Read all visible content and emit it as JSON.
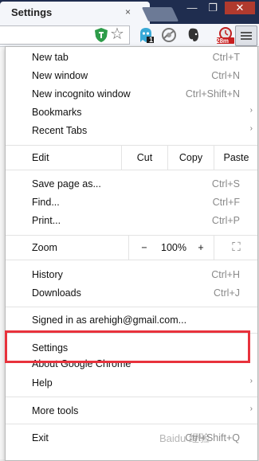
{
  "tab": {
    "title": "Settings",
    "close": "×"
  },
  "window_controls": {
    "minimize": "—",
    "maximize": "❐",
    "close": "✕"
  },
  "toolbar": {
    "star": "☆",
    "timer_badge": "28m",
    "ghost_badge": "1"
  },
  "menu": {
    "items_top": [
      {
        "label": "New tab",
        "shortcut": "Ctrl+T"
      },
      {
        "label": "New window",
        "shortcut": "Ctrl+N"
      },
      {
        "label": "New incognito window",
        "shortcut": "Ctrl+Shift+N"
      },
      {
        "label": "Bookmarks",
        "submenu": "›"
      },
      {
        "label": "Recent Tabs",
        "submenu": "›"
      }
    ],
    "edit": {
      "label": "Edit",
      "cut": "Cut",
      "copy": "Copy",
      "paste": "Paste"
    },
    "items_page": [
      {
        "label": "Save page as...",
        "shortcut": "Ctrl+S"
      },
      {
        "label": "Find...",
        "shortcut": "Ctrl+F"
      },
      {
        "label": "Print...",
        "shortcut": "Ctrl+P"
      }
    ],
    "zoom": {
      "label": "Zoom",
      "minus": "−",
      "level": "100%",
      "plus": "+",
      "fullscreen": "⛶"
    },
    "items_history": [
      {
        "label": "History",
        "shortcut": "Ctrl+H"
      },
      {
        "label": "Downloads",
        "shortcut": "Ctrl+J"
      }
    ],
    "signed_in": "Signed in as arehigh@gmail.com...",
    "items_settings": [
      {
        "label": "Settings"
      },
      {
        "label": "About Google Chrome"
      },
      {
        "label": "Help",
        "submenu": "›"
      }
    ],
    "more_tools": {
      "label": "More tools",
      "submenu": "›"
    },
    "exit": {
      "label": "Exit",
      "shortcut": "Ctrl+Shift+Q"
    }
  },
  "watermark": "Baidu 经验",
  "colors": {
    "highlight": "#e8323c",
    "titlebar": "#1f2d4f",
    "close_button": "#b03a2e"
  }
}
